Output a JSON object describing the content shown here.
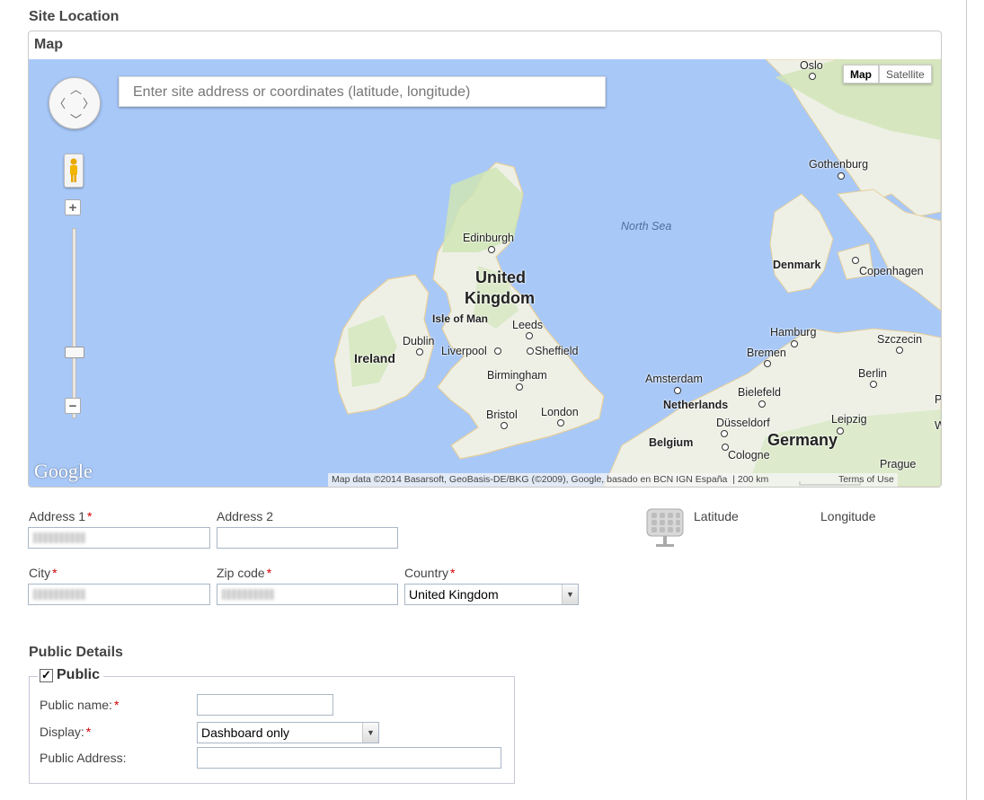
{
  "site_location": {
    "title": "Site Location"
  },
  "map": {
    "panel_title": "Map",
    "search_placeholder": "Enter site address or coordinates (latitude, longitude)",
    "map_type_buttons": {
      "map": "Map",
      "satellite": "Satellite"
    },
    "logo_text": "Google",
    "attribution": "Map data ©2014 Basarsoft, GeoBasis-DE/BKG (©2009), Google, basado en BCN IGN España",
    "scale_text": "200 km",
    "terms_text": "Terms of Use",
    "zoom_in": "+",
    "zoom_out": "−",
    "labels": {
      "oslo": "Oslo",
      "gothenburg": "Gothenburg",
      "north_sea": "North Sea",
      "edinburgh": "Edinburgh",
      "united": "United",
      "kingdom": "Kingdom",
      "denmark": "Denmark",
      "copenhagen": "Copenhagen",
      "isle_of_man": "Isle of Man",
      "leeds": "Leeds",
      "dublin": "Dublin",
      "liverpool": "Liverpool",
      "sheffield": "Sheffield",
      "ireland": "Ireland",
      "hamburg": "Hamburg",
      "szczecin": "Szczecin",
      "bremen": "Bremen",
      "berlin": "Berlin",
      "birmingham": "Birmingham",
      "amsterdam": "Amsterdam",
      "bielefeld": "Bielefeld",
      "netherlands": "Netherlands",
      "bristol": "Bristol",
      "london": "London",
      "dusseldorf": "Düsseldorf",
      "leipzig": "Leipzig",
      "belgium": "Belgium",
      "germany": "Germany",
      "cologne": "Cologne",
      "prague": "Prague",
      "edge_p": "P",
      "edge_w": "W"
    }
  },
  "address": {
    "address1_label": "Address 1",
    "address2_label": "Address 2",
    "city_label": "City",
    "zip_label": "Zip code",
    "country_label": "Country",
    "country_value": "United Kingdom",
    "latitude_label": "Latitude",
    "longitude_label": "Longitude",
    "required_mark": "*"
  },
  "public_details": {
    "title": "Public Details",
    "public_label": "Public",
    "public_checked": true,
    "check_mark": "✓",
    "public_name_label": "Public name:",
    "display_label": "Display:",
    "display_value": "Dashboard only",
    "public_address_label": "Public Address:",
    "required_mark": "*"
  },
  "colors": {
    "water": "#a8c8f8",
    "land": "#eef0e6",
    "green": "#cfe5b5",
    "required": "#d40000"
  }
}
